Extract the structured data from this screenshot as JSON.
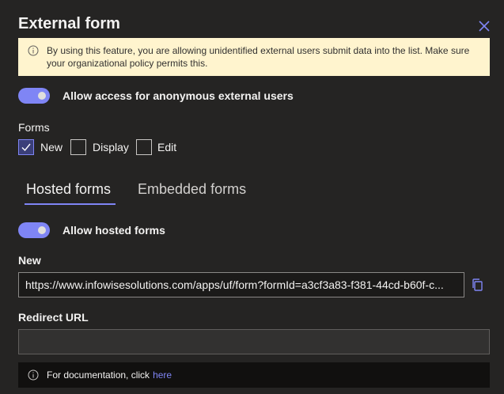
{
  "dialog": {
    "title": "External form",
    "warning": "By using this feature, you are allowing unidentified external users submit data into the list. Make sure your organizational policy permits this."
  },
  "anonymous_toggle": {
    "label": "Allow access for anonymous external users",
    "on": true
  },
  "forms": {
    "label": "Forms",
    "options": [
      {
        "label": "New",
        "checked": true
      },
      {
        "label": "Display",
        "checked": false
      },
      {
        "label": "Edit",
        "checked": false
      }
    ]
  },
  "tabs": [
    {
      "label": "Hosted forms",
      "active": true
    },
    {
      "label": "Embedded forms",
      "active": false
    }
  ],
  "hosted_toggle": {
    "label": "Allow hosted forms",
    "on": true
  },
  "new_url": {
    "label": "New",
    "value": "https://www.infowisesolutions.com/apps/uf/form?formId=a3cf3a83-f381-44cd-b60f-c..."
  },
  "redirect": {
    "label": "Redirect URL",
    "value": ""
  },
  "documentation": {
    "text": "For documentation, click",
    "link": "here"
  },
  "colors": {
    "accent": "#7f85f5",
    "warning_bg": "#fff4ce",
    "panel_bg": "#252423"
  }
}
